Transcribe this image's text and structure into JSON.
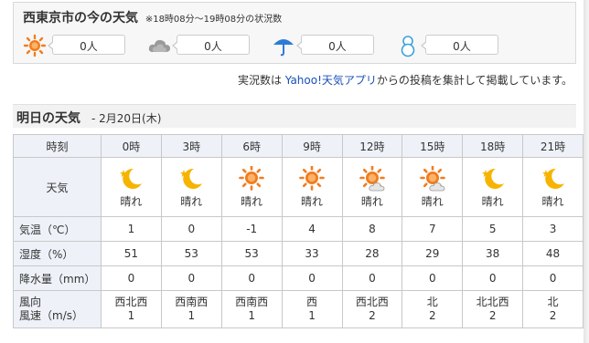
{
  "report": {
    "title": "西東京市の今の天気",
    "note": "※18時08分～19時08分の状況数",
    "items": [
      {
        "icon": "sun-icon",
        "value": "0人"
      },
      {
        "icon": "cloud-icon",
        "value": "0人"
      },
      {
        "icon": "umbrella-icon",
        "value": "0人"
      },
      {
        "icon": "snowman-icon",
        "value": "0人"
      }
    ],
    "source": {
      "prefix": "実況数は ",
      "link": "Yahoo!天気アプリ",
      "suffix": "からの投稿を集計して掲載しています。"
    }
  },
  "tomorrow": {
    "title": "明日の天気",
    "date": "- 2月20日(木)",
    "labels": {
      "time": "時刻",
      "weather": "天気",
      "temp": "気温（℃）",
      "humidity": "湿度（%）",
      "precip": "降水量（mm）",
      "wind_dir": "風向",
      "wind_speed": "風速（m/s）"
    },
    "hours": [
      {
        "time": "0時",
        "icon": "moon-icon",
        "weather": "晴れ",
        "temp": "1",
        "humidity": "51",
        "precip": "0",
        "wind_dir": "西北西",
        "wind_speed": "1"
      },
      {
        "time": "3時",
        "icon": "moon-icon",
        "weather": "晴れ",
        "temp": "0",
        "humidity": "53",
        "precip": "0",
        "wind_dir": "西南西",
        "wind_speed": "1"
      },
      {
        "time": "6時",
        "icon": "sun-icon",
        "weather": "晴れ",
        "temp": "-1",
        "humidity": "53",
        "precip": "0",
        "wind_dir": "西南西",
        "wind_speed": "1"
      },
      {
        "time": "9時",
        "icon": "sun-icon",
        "weather": "晴れ",
        "temp": "4",
        "humidity": "33",
        "precip": "0",
        "wind_dir": "西",
        "wind_speed": "1"
      },
      {
        "time": "12時",
        "icon": "sun-cloud-icon",
        "weather": "晴れ",
        "temp": "8",
        "humidity": "28",
        "precip": "0",
        "wind_dir": "西北西",
        "wind_speed": "2"
      },
      {
        "time": "15時",
        "icon": "sun-cloud-icon",
        "weather": "晴れ",
        "temp": "7",
        "humidity": "29",
        "precip": "0",
        "wind_dir": "北",
        "wind_speed": "2"
      },
      {
        "time": "18時",
        "icon": "moon-icon",
        "weather": "晴れ",
        "temp": "5",
        "humidity": "38",
        "precip": "0",
        "wind_dir": "北北西",
        "wind_speed": "2"
      },
      {
        "time": "21時",
        "icon": "moon-icon",
        "weather": "晴れ",
        "temp": "3",
        "humidity": "48",
        "precip": "0",
        "wind_dir": "北",
        "wind_speed": "2"
      }
    ]
  },
  "colors": {
    "sun": "#f27c1e",
    "moon": "#f6b400",
    "cloud": "#9a9a9a",
    "umbrella": "#2e7bd6",
    "snowman": "#3aa3d8",
    "link": "#1a4fb8",
    "header_bg": "#eef2f8"
  }
}
